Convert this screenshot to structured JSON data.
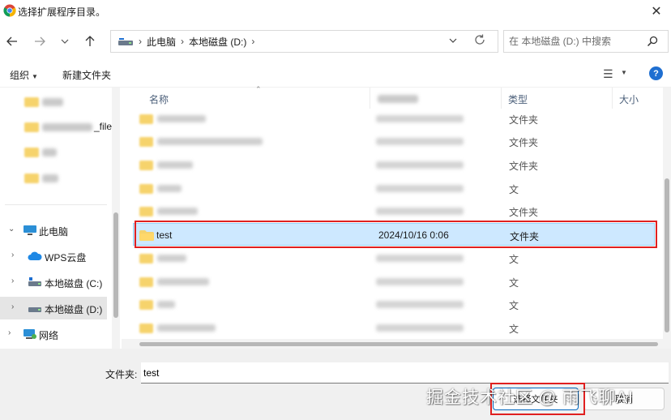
{
  "window": {
    "title": "选择扩展程序目录。",
    "close_label": "✕"
  },
  "address": {
    "crumbs": [
      "此电脑",
      "本地磁盘 (D:)"
    ],
    "search_placeholder": "在 本地磁盘 (D:) 中搜索"
  },
  "toolbar": {
    "organize_label": "组织",
    "new_folder_label": "新建文件夹",
    "help_label": "?"
  },
  "nav": {
    "blurred_item_suffix": "_file",
    "items": [
      {
        "label": "此电脑",
        "icon": "computer-icon",
        "expandable": true,
        "expanded": true
      },
      {
        "label": "WPS云盘",
        "icon": "cloud-icon",
        "expandable": true
      },
      {
        "label": "本地磁盘 (C:)",
        "icon": "drive-icon",
        "expandable": true
      },
      {
        "label": "本地磁盘 (D:)",
        "icon": "drive-icon",
        "expandable": true,
        "selected": true
      },
      {
        "label": "网络",
        "icon": "network-icon",
        "expandable": true
      }
    ]
  },
  "files": {
    "columns": {
      "name": "名称",
      "type": "类型",
      "size": "大小"
    },
    "selected_row": {
      "name": "test",
      "date": "2024/10/16 0:06",
      "type": "文件夹"
    },
    "visible_types": [
      "文件夹",
      "文件夹",
      "文件夹",
      "文",
      "文件夹",
      "文",
      "文",
      "文",
      "文"
    ]
  },
  "bottom": {
    "folder_label": "文件夹:",
    "folder_value": "test",
    "select_button": "选择文件夹",
    "cancel_button": "取消"
  },
  "watermark": "掘金技术社区 @ 雨飞聊AI",
  "colors": {
    "accent": "#0067c0",
    "selection_bg": "#cde8ff",
    "annotation_red": "#e02020",
    "folder": "#f6d36c"
  }
}
